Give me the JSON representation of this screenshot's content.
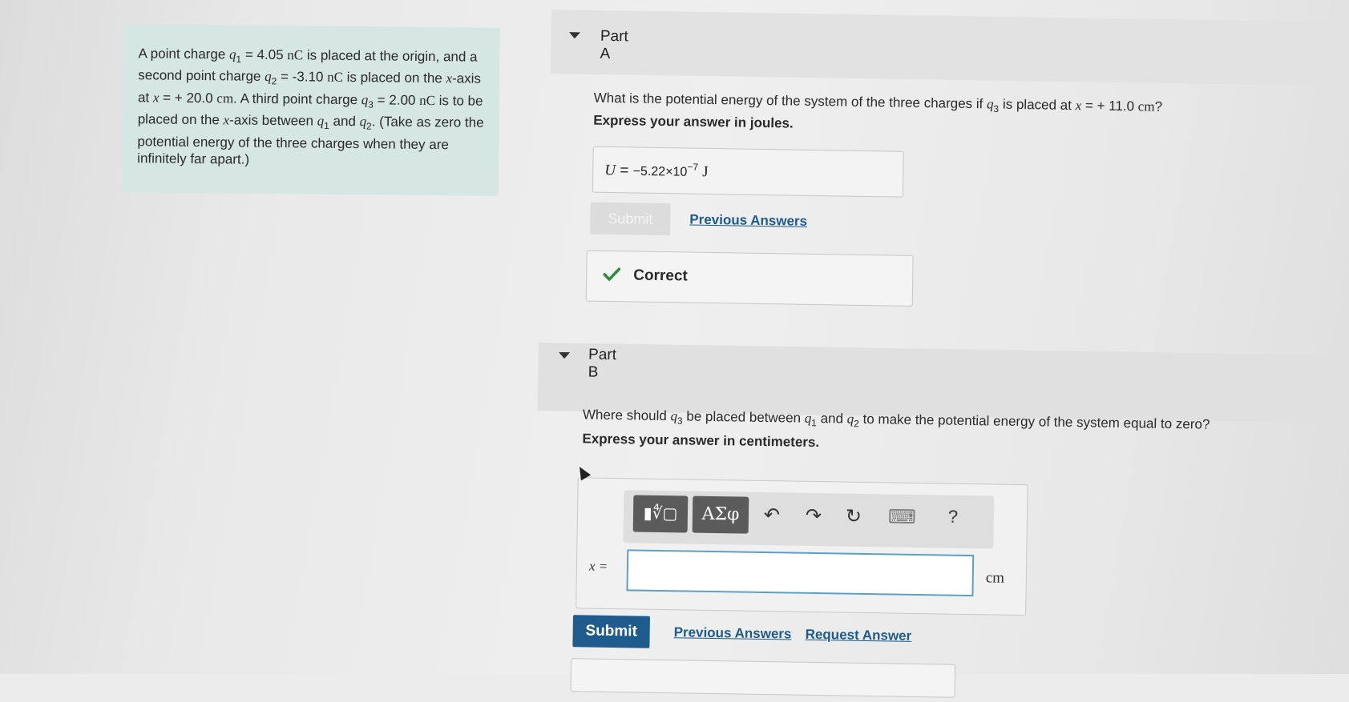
{
  "problem": {
    "t1": "A point charge ",
    "q1": "q",
    "q1_sub": "1",
    "eq1": " = 4.05 ",
    "u1": "nC",
    "t2": " is placed at the origin, and a second point charge ",
    "q2": "q",
    "q2_sub": "2",
    "eq2": " = -3.10 ",
    "u2": "nC",
    "t3": " is placed on the ",
    "x1": "x",
    "t4": "-axis at ",
    "x2": "x",
    "eq3": " = + 20.0 ",
    "u3": "cm",
    "t5": ". A third point charge ",
    "q3": "q",
    "q3_sub": "3",
    "eq4": " = 2.00 ",
    "u4": "nC",
    "t6": " is to be placed on the ",
    "x3": "x",
    "t7": "-axis between ",
    "q4": "q",
    "q4_sub": "1",
    "t8": " and ",
    "q5": "q",
    "q5_sub": "2",
    "t9": ". (Take as zero the potential energy of the three charges when they are infinitely far apart.)"
  },
  "part_a": {
    "title": "Part A",
    "q_t1": "What is the potential energy of the system of the three charges if ",
    "q_var": "q",
    "q_sub": "3",
    "q_t2": " is placed at ",
    "q_x": "x",
    "q_eq": " = + 11.0 ",
    "q_unit": "cm",
    "q_end": "?",
    "instruction": "Express your answer in joules.",
    "answer_var": "U",
    "answer_eq": " = ",
    "answer_value": "−5.22×10",
    "answer_exp": "−7",
    "answer_unit": "J",
    "submit_label": "Submit",
    "previous_answers": "Previous Answers",
    "correct_label": "Correct"
  },
  "part_b": {
    "title": "Part B",
    "q_t1": "Where should ",
    "q_var1": "q",
    "q_sub1": "3",
    "q_t2": " be placed between ",
    "q_var2": "q",
    "q_sub2": "1",
    "q_t3": " and ",
    "q_var3": "q",
    "q_sub3": "2",
    "q_t4": " to make the potential energy of the system equal to zero?",
    "instruction": "Express your answer in centimeters.",
    "toolbar": {
      "templates_label": "▮∜▢",
      "symbols_label": "ΑΣφ",
      "undo_icon": "↶",
      "redo_icon": "↷",
      "reset_icon": "↻",
      "keyboard_icon": "⌨",
      "help_label": "?"
    },
    "var_label": "x =",
    "answer_value": "",
    "unit": "cm",
    "submit_label": "Submit",
    "previous_answers": "Previous Answers",
    "request_answer": "Request Answer"
  },
  "colors": {
    "accent": "#1f5b8c",
    "correct_green": "#2e8b3a",
    "problem_bg": "#d6e6e3"
  }
}
